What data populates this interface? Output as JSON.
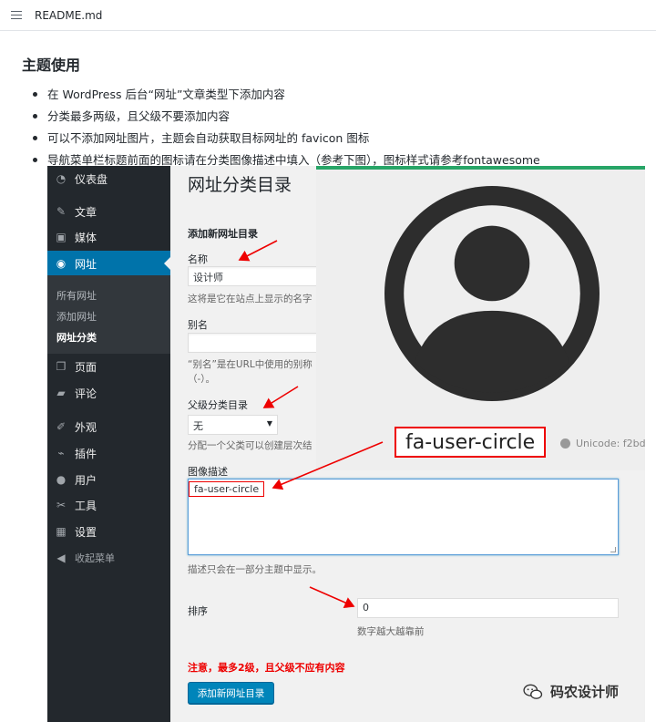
{
  "file": {
    "name": "README.md",
    "icon": "list-icon"
  },
  "doc": {
    "heading": "主题使用",
    "bullets": [
      "在 WordPress 后台“网址”文章类型下添加内容",
      "分类最多两级，且父级不要添加内容",
      "可以不添加网址图片，主题会自动获取目标网址的 favicon 图标",
      "导航菜单栏标题前面的图标请在分类图像描述中填入（参考下图），图标样式请参考fontawesome"
    ]
  },
  "wp": {
    "menu": [
      {
        "label": "仪表盘",
        "icon": "dashboard-icon"
      },
      {
        "label": "文章",
        "icon": "pin-icon"
      },
      {
        "label": "媒体",
        "icon": "media-icon"
      },
      {
        "label": "网址",
        "icon": "globe-icon",
        "active": true
      },
      {
        "label": "页面",
        "icon": "page-icon"
      },
      {
        "label": "评论",
        "icon": "comment-icon"
      },
      {
        "label": "外观",
        "icon": "brush-icon"
      },
      {
        "label": "插件",
        "icon": "plugin-icon"
      },
      {
        "label": "用户",
        "icon": "user-icon"
      },
      {
        "label": "工具",
        "icon": "wrench-icon"
      },
      {
        "label": "设置",
        "icon": "settings-icon"
      },
      {
        "label": "收起菜单",
        "icon": "collapse-icon"
      }
    ],
    "submenu": [
      "所有网址",
      "添加网址",
      "网址分类"
    ],
    "page_title": "网址分类目录",
    "form": {
      "section_title": "添加新网址目录",
      "name_label": "名称",
      "name_value": "设计师",
      "name_desc": "这将是它在站点上显示的名字",
      "slug_label": "别名",
      "slug_value": "",
      "slug_desc_1": "“别名”是在URL中使用的别称",
      "slug_desc_2": "（-）。",
      "parent_label": "父级分类目录",
      "parent_value": "无",
      "parent_desc": "分配一个父类可以创建层次结",
      "image_label": "图像描述",
      "image_value": "fa-user-circle",
      "image_desc": "描述只会在一部分主题中显示。",
      "order_label": "排序",
      "order_value": "0",
      "order_desc": "数字越大越靠前",
      "warning": "注意，最多2级，且父级不应有内容",
      "submit": "添加新网址目录"
    }
  },
  "overlay": {
    "icon": "user-circle-icon",
    "name": "fa-user-circle",
    "unicode": "Unicode: f2bd",
    "accent": "#27a567"
  },
  "watermark": {
    "text": "码农设计师",
    "icon": "wechat-icon"
  },
  "colors": {
    "wp_sidebar": "#23282d",
    "wp_active": "#0073aa",
    "warning": "#e00000",
    "button": "#0085ba"
  }
}
